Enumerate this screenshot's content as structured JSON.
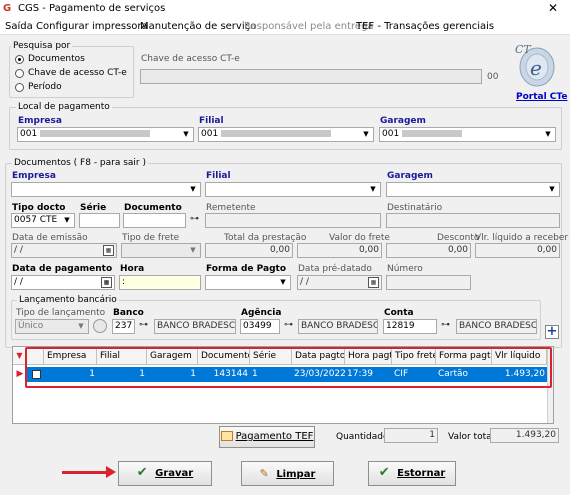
{
  "window": {
    "title": "CGS - Pagamento de serviços"
  },
  "menu": [
    "Saída",
    "Configurar impressora",
    "Manutenção de serviço",
    "Responsável pela entrega",
    "TEF - Transações gerenciais"
  ],
  "pesquisa": {
    "label": "Pesquisa por",
    "options": [
      "Documentos",
      "Chave de acesso CT-e",
      "Período"
    ],
    "selected": "Documentos",
    "chave_label": "Chave de acesso CT-e",
    "chave_value": "",
    "chave_suffix": "00"
  },
  "portal": {
    "logo_text": "CT e",
    "link": "Portal CTe"
  },
  "local": {
    "label": "Local de pagamento",
    "empresa_label": "Empresa",
    "empresa_value": "001",
    "filial_label": "Filial",
    "filial_value": "001",
    "garagem_label": "Garagem",
    "garagem_value": "001"
  },
  "documentos": {
    "label": "Documentos ( F8 - para sair )",
    "empresa_label": "Empresa",
    "filial_label": "Filial",
    "garagem_label": "Garagem",
    "tipo_docto_label": "Tipo docto",
    "tipo_docto_value": "0057 CTE",
    "serie_label": "Série",
    "serie_value": "",
    "documento_label": "Documento",
    "documento_value": "",
    "remetente_label": "Remetente",
    "destinatario_label": "Destinatário",
    "emissao_label": "Data de emissão",
    "emissao_value": "/ /",
    "tipo_frete_label": "Tipo de frete",
    "total_prest_label": "Total da prestação",
    "total_prest_value": "0,00",
    "valor_frete_label": "Valor do frete",
    "valor_frete_value": "0,00",
    "desconto_label": "Desconto",
    "desconto_value": "0,00",
    "vlr_liquido_label": "Vlr. líquido a receber",
    "vlr_liquido_value": "0,00",
    "data_pag_label": "Data de pagamento",
    "data_pag_value": "/ /",
    "hora_label": "Hora",
    "hora_value": ":",
    "forma_pag_label": "Forma de Pagto",
    "pre_datado_label": "Data pré-datado",
    "pre_datado_value": "/ /",
    "numero_label": "Número"
  },
  "lancamento": {
    "label": "Lançamento bancário",
    "tipo_label": "Tipo de lançamento",
    "tipo_value": "Único",
    "banco_label": "Banco",
    "banco_code": "237",
    "banco_name": "BANCO BRADESCO",
    "agencia_label": "Agência",
    "agencia_code": "03499",
    "agencia_name": "BANCO BRADESCO",
    "conta_label": "Conta",
    "conta_code": "12819",
    "conta_name": "BANCO BRADESCO",
    "add_label": "+"
  },
  "grid": {
    "columns": [
      "",
      "Empresa",
      "Filial",
      "Garagem",
      "Documento",
      "Série",
      "Data pagto",
      "Hora pagto",
      "Tipo frete",
      "Forma pagto",
      "Vlr líquido"
    ],
    "row": [
      "",
      "1",
      "1",
      "1",
      "143144",
      "1",
      "23/03/2022",
      "17:39",
      "CIF",
      "Cartão",
      "1.493,20"
    ]
  },
  "bottom": {
    "pagamento_tef": "Pagamento TEF",
    "quantidade_label": "Quantidade",
    "quantidade_value": "1",
    "valor_total_label": "Valor total",
    "valor_total_value": "1.493,20"
  },
  "actions": {
    "gravar": "Gravar",
    "limpar": "Limpar",
    "estornar": "Estornar"
  },
  "colors": {
    "selection": "#0078d7",
    "highlight": "#d9232e",
    "label_blue": "#1a1a99"
  }
}
